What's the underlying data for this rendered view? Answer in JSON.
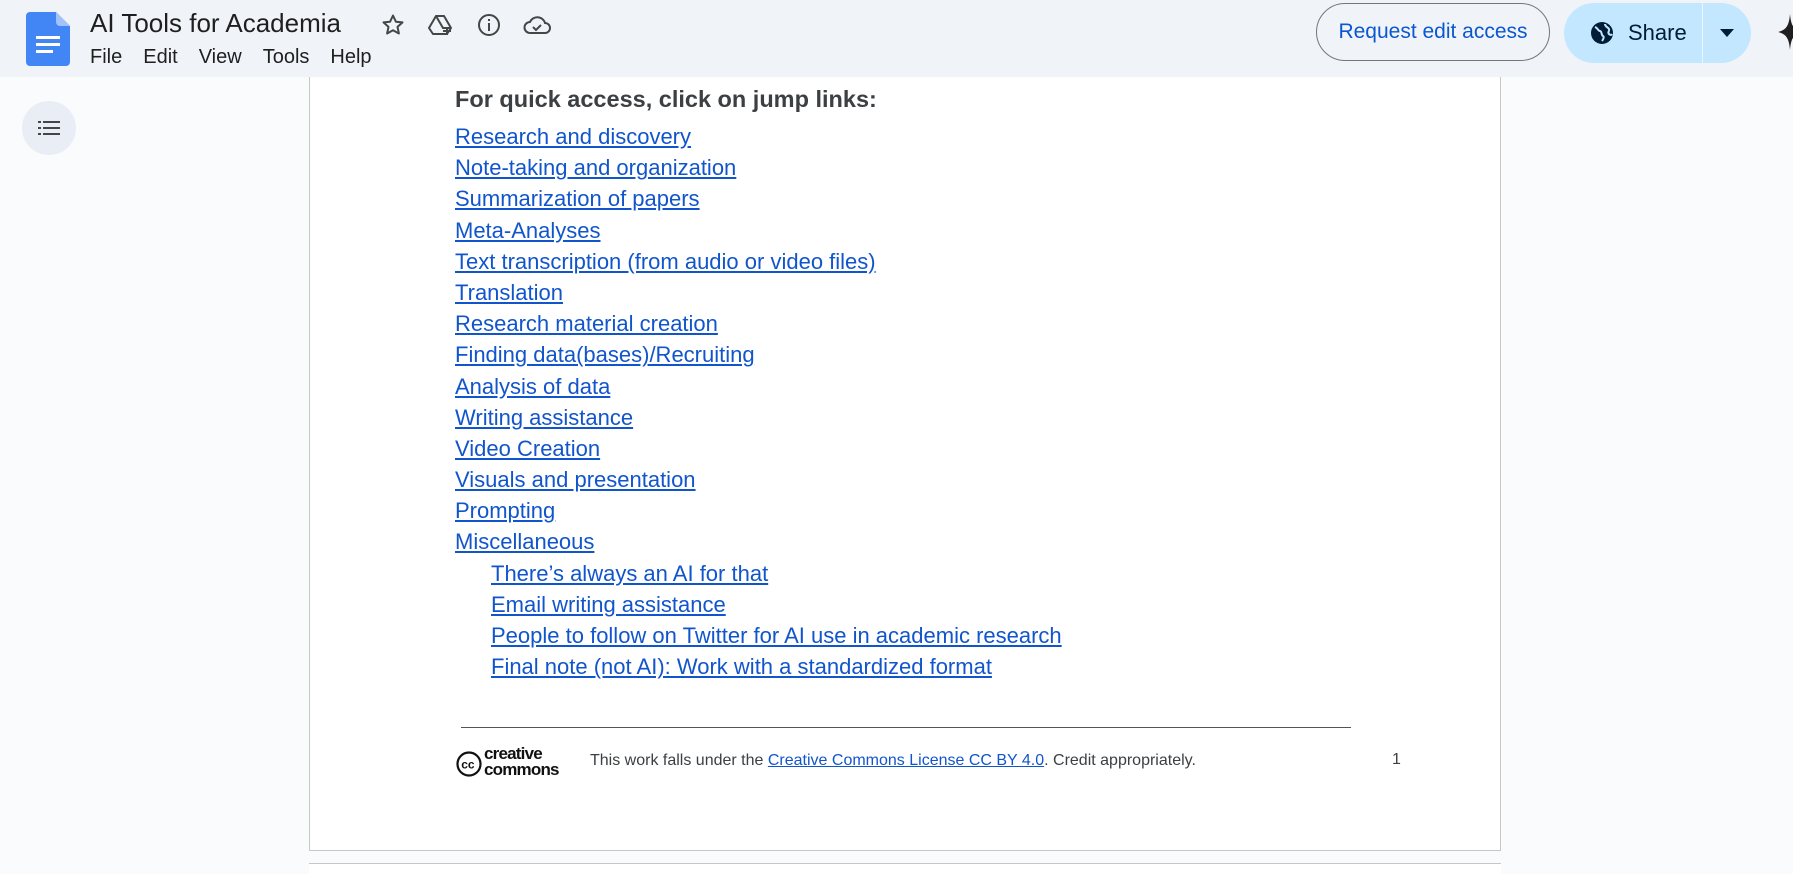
{
  "doc": {
    "title": "AI Tools for Academia"
  },
  "menu": {
    "items": [
      "File",
      "Edit",
      "View",
      "Tools",
      "Help"
    ]
  },
  "actions": {
    "request_edit_label": "Request edit access",
    "share_label": "Share"
  },
  "content": {
    "heading": "For quick access, click on jump links:",
    "links": [
      "Research and discovery",
      "Note-taking and organization",
      "Summarization of papers",
      "Meta-Analyses",
      "Text transcription (from audio or video files)",
      "Translation",
      "Research material creation",
      "Finding data(bases)/Recruiting",
      "Analysis of data",
      "Writing assistance",
      "Video Creation",
      "Visuals and presentation",
      "Prompting",
      "Miscellaneous"
    ],
    "sublinks": [
      "There’s always an AI for that",
      "Email writing assistance",
      "People to follow on Twitter for AI use in academic research",
      "Final note (not AI): Work with a standardized format"
    ]
  },
  "footer": {
    "logo_text_1": "creative",
    "logo_text_2": "commons",
    "text_before": "This work falls under the ",
    "license_link": "Creative Commons License CC BY 4.0",
    "text_after": ". Credit appropriately.",
    "page_number": "1"
  },
  "colors": {
    "link": "#1155cc",
    "accent": "#0b57d0",
    "share_bg": "#c2e7ff",
    "docs_blue": "#4285f4"
  }
}
